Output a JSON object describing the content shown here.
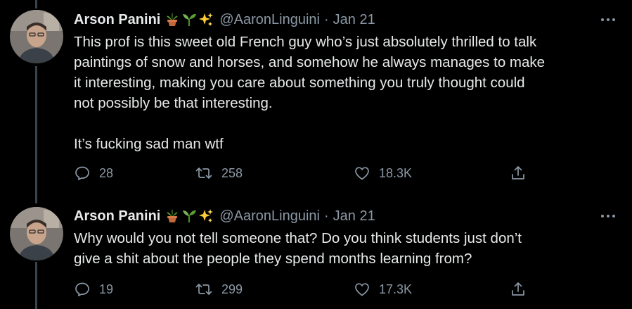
{
  "tweets": [
    {
      "author_name": "Arson Panini",
      "name_emojis": [
        "potted-plant-emoji",
        "seedling-emoji",
        "sparkles-emoji"
      ],
      "handle": "@AaronLinguini",
      "separator": "·",
      "date": "Jan 21",
      "text": "This prof is this sweet old French guy who’s just absolutely thrilled to talk\npaintings of snow and horses, and somehow he always manages to make\nit interesting, making you care about something you truly thought could\nnot possibly be that interesting.\n\nIt’s fucking sad man wtf",
      "replies": "28",
      "retweets": "258",
      "likes": "18.3K"
    },
    {
      "author_name": "Arson Panini",
      "name_emojis": [
        "potted-plant-emoji",
        "seedling-emoji",
        "sparkles-emoji"
      ],
      "handle": "@AaronLinguini",
      "separator": "·",
      "date": "Jan 21",
      "text": "Why would you not tell someone that? Do you think students just don’t\ngive a shit about the people they spend months learning from?",
      "replies": "19",
      "retweets": "299",
      "likes": "17.3K"
    }
  ],
  "colors": {
    "background": "#000000",
    "primary_text": "#e7e9ea",
    "secondary_text": "#8b98a5",
    "thread_line": "#38444d"
  }
}
